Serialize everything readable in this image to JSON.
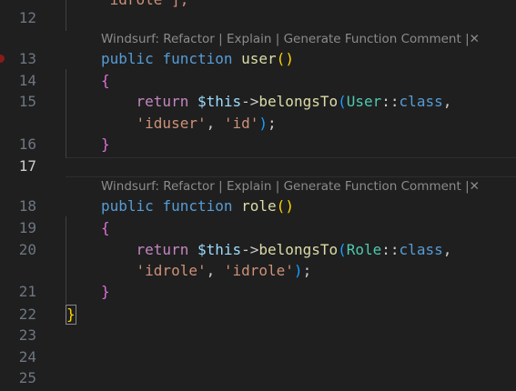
{
  "gutter": {
    "line_numbers": [
      "12",
      "13",
      "14",
      "15",
      "16",
      "17",
      "18",
      "19",
      "20",
      "21",
      "22",
      "23",
      "24",
      "25"
    ]
  },
  "top_partial": "'idrole'];",
  "codelens": {
    "brand": "Windsurf:",
    "refactor": "Refactor",
    "explain": "Explain",
    "generate_comment": "Generate Function Comment",
    "separator": "|",
    "close": "✕"
  },
  "code": {
    "kw_public": "public",
    "kw_function": "function",
    "kw_return": "return",
    "var_this": "$this",
    "arrow": "->",
    "method_belongs": "belongsTo",
    "class_kw": "class",
    "scope": "::",
    "user_fn": "user",
    "role_fn": "role",
    "user_cls": "User",
    "role_cls": "Role",
    "paren_open": "(",
    "paren_close": ")",
    "brace_open": "{",
    "brace_close": "}",
    "comma": ",",
    "semicolon": ";",
    "comma_space": ", ",
    "str_iduser": "'iduser'",
    "str_id": "'id'",
    "str_idrole": "'idrole'"
  }
}
